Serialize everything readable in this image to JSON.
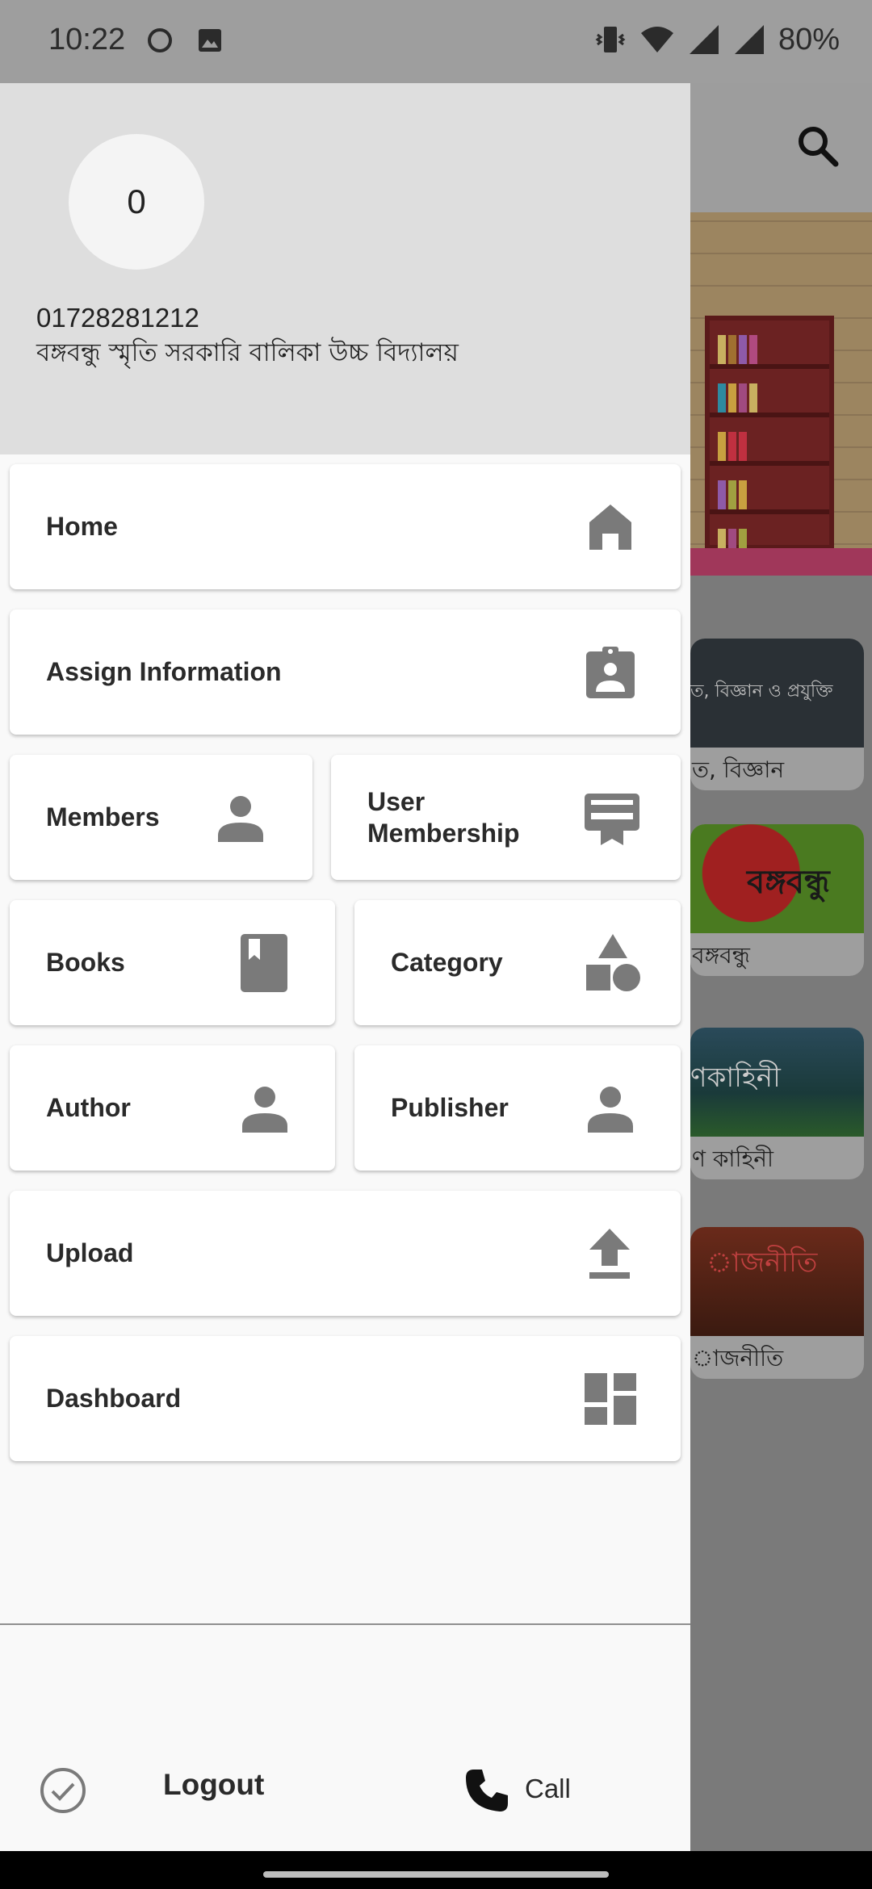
{
  "status_bar": {
    "time": "10:22",
    "battery": "80%",
    "icons": [
      "circle-notification-icon",
      "gallery-icon",
      "vibrate-icon",
      "wifi-icon",
      "signal-icon",
      "signal-icon"
    ]
  },
  "drawer": {
    "avatar_text": "0",
    "phone_number": "01728281212",
    "school_name": "বঙ্গবন্ধু স্মৃতি সরকারি বালিকা উচ্চ বিদ্যালয়",
    "menu": {
      "home": "Home",
      "assign_information": "Assign Information",
      "members": "Members",
      "user_membership": "User Membership",
      "books": "Books",
      "category": "Category",
      "author": "Author",
      "publisher": "Publisher",
      "upload": "Upload",
      "dashboard": "Dashboard"
    },
    "footer": {
      "logout": "Logout",
      "call": "Call"
    }
  },
  "background": {
    "cards": [
      {
        "caption": "ত, বিজ্ঞান",
        "image_text": "ত, বিজ্ঞান ও প্রযুক্তি"
      },
      {
        "caption": "বঙ্গবন্ধু",
        "image_text": "বঙ্গবন্ধু"
      },
      {
        "caption": "ণ কাহিনী",
        "image_text": "ণকাহিনী"
      },
      {
        "caption": "াজনীতি",
        "image_text": "াজনীতি"
      }
    ]
  },
  "colors": {
    "drawer_header": "#dedede",
    "drawer_body": "#f9f9f9",
    "icon_gray": "#7a7a7a",
    "text": "#2a2a2a"
  }
}
